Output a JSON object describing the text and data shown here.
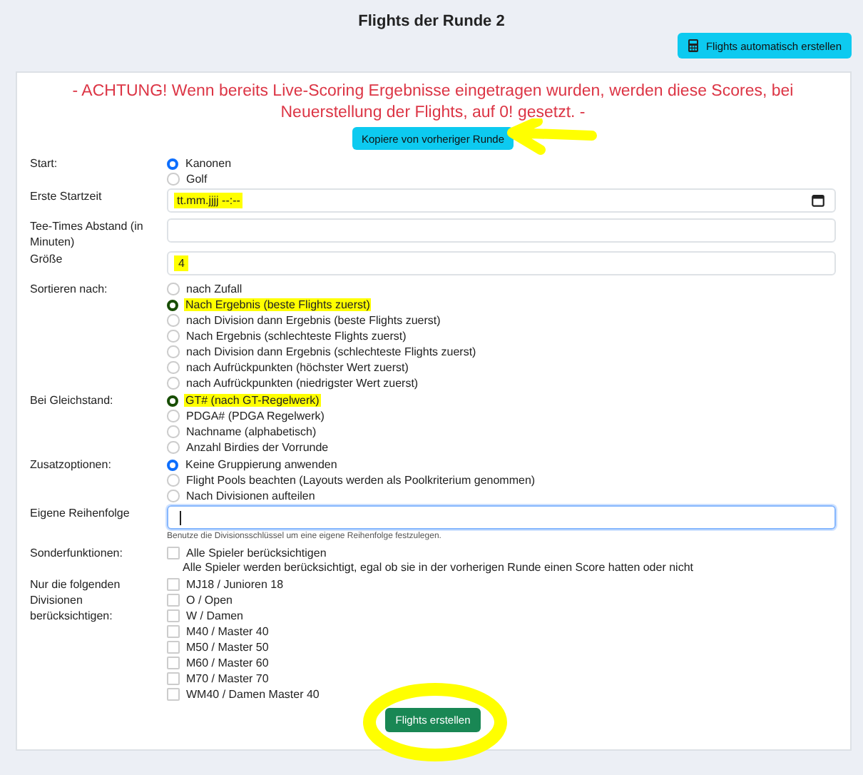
{
  "title": "Flights der Runde 2",
  "auto_button": {
    "label": "Flights automatisch erstellen"
  },
  "warning": "- ACHTUNG! Wenn bereits Live-Scoring Ergebnisse eingetragen wurden, werden diese Scores, bei Neuerstellung der Flights, auf 0! gesetzt. -",
  "copy_button": {
    "label": "Kopiere von vorheriger Runde",
    "arrow_marked": true
  },
  "fields": [
    {
      "kind": "radio",
      "label": "Start:",
      "options": [
        {
          "label": "Kanonen",
          "selected": true,
          "highlighted": false
        },
        {
          "label": "Golf",
          "selected": false,
          "highlighted": false
        }
      ]
    },
    {
      "kind": "datetime",
      "label": "Erste Startzeit",
      "placeholder": "tt.mm.jjjj --:--",
      "highlighted": true,
      "focused": false
    },
    {
      "kind": "text",
      "label": "Tee-Times Abstand (in Minuten)",
      "focused": false
    },
    {
      "kind": "text",
      "label": "Größe",
      "value": "4",
      "highlighted": true,
      "focused": false
    },
    {
      "kind": "radio",
      "label": "Sortieren nach:",
      "options": [
        {
          "label": "nach Zufall",
          "selected": false,
          "highlighted": false
        },
        {
          "label": "Nach Ergebnis (beste Flights zuerst)",
          "selected": true,
          "highlighted": true
        },
        {
          "label": "nach Division dann Ergebnis (beste Flights zuerst)",
          "selected": false,
          "highlighted": false
        },
        {
          "label": "Nach Ergebnis (schlechteste Flights zuerst)",
          "selected": false,
          "highlighted": false
        },
        {
          "label": "nach Division dann Ergebnis (schlechteste Flights zuerst)",
          "selected": false,
          "highlighted": false
        },
        {
          "label": "nach Aufrückpunkten (höchster Wert zuerst)",
          "selected": false,
          "highlighted": false
        },
        {
          "label": "nach Aufrückpunkten (niedrigster Wert zuerst)",
          "selected": false,
          "highlighted": false
        }
      ]
    },
    {
      "kind": "radio",
      "label": "Bei Gleichstand:",
      "options": [
        {
          "label": "GT# (nach GT-Regelwerk)",
          "selected": true,
          "highlighted": true
        },
        {
          "label": "PDGA# (PDGA Regelwerk)",
          "selected": false,
          "highlighted": false
        },
        {
          "label": "Nachname (alphabetisch)",
          "selected": false,
          "highlighted": false
        },
        {
          "label": "Anzahl Birdies der Vorrunde",
          "selected": false,
          "highlighted": false
        }
      ]
    },
    {
      "kind": "radio",
      "label": "Zusatzoptionen:",
      "options": [
        {
          "label": "Keine Gruppierung anwenden",
          "selected": true,
          "highlighted": false
        },
        {
          "label": "Flight Pools beachten (Layouts werden als Poolkriterium genommen)",
          "selected": false,
          "highlighted": false
        },
        {
          "label": "Nach Divisionen aufteilen",
          "selected": false,
          "highlighted": false
        }
      ]
    },
    {
      "kind": "text",
      "label": "Eigene Reihenfolge",
      "focused": true,
      "help": "Benutze die Divisionsschlüssel um eine eigene Reihenfolge festzulegen."
    },
    {
      "kind": "checkbox",
      "label": "Sonderfunktionen:",
      "options": [
        {
          "label": "Alle Spieler berücksichtigen",
          "checked": false,
          "description": "Alle Spieler werden berücksichtigt, egal ob sie in der vorherigen Runde einen Score hatten oder nicht"
        }
      ]
    },
    {
      "kind": "checkbox",
      "label": "Nur die folgenden Divisionen berücksichtigen:",
      "options": [
        {
          "label": "MJ18 / Junioren 18",
          "checked": false
        },
        {
          "label": "O / Open",
          "checked": false
        },
        {
          "label": "W / Damen",
          "checked": false
        },
        {
          "label": "M40 / Master 40",
          "checked": false
        },
        {
          "label": "M50 / Master 50",
          "checked": false
        },
        {
          "label": "M60 / Master 60",
          "checked": false
        },
        {
          "label": "M70 / Master 70",
          "checked": false
        },
        {
          "label": "WM40 / Damen Master 40",
          "checked": false
        }
      ]
    }
  ],
  "create_button": {
    "label": "Flights erstellen",
    "circled": true
  }
}
